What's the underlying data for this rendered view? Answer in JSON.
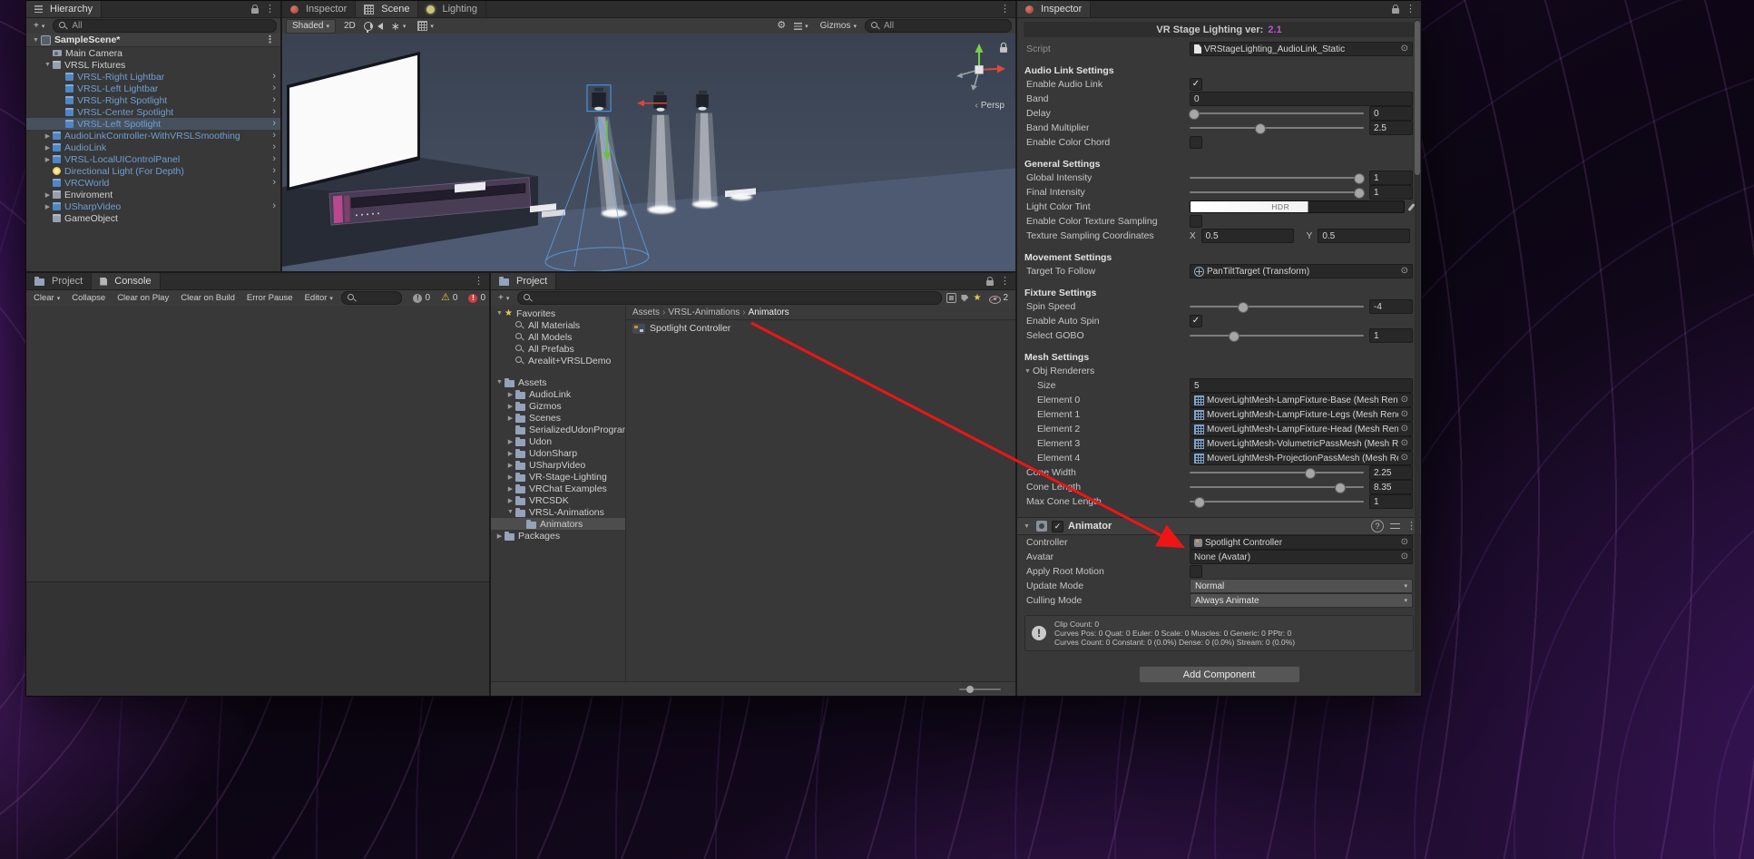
{
  "colors": {
    "selection_blue": "#47515e",
    "prefab_text": "#6f9fd6",
    "version_accent": "#c44fd4",
    "annotation_red": "#ed1515",
    "folder_icon": "#94a3bb"
  },
  "hierarchy": {
    "tab": "Hierarchy",
    "add_button": "+",
    "search_text": "All",
    "scene_label": "SampleScene*",
    "items": [
      {
        "label": "Main Camera",
        "lvl": 1,
        "icon": "camera",
        "prefab": false
      },
      {
        "label": "VRSL Fixtures",
        "lvl": 1,
        "icon": "cube",
        "prefab": false,
        "fold": "open"
      },
      {
        "label": "VRSL-Right Lightbar",
        "lvl": 2,
        "icon": "prefab",
        "prefab": true,
        "chev": true
      },
      {
        "label": "VRSL-Left Lightbar",
        "lvl": 2,
        "icon": "prefab",
        "prefab": true,
        "chev": true
      },
      {
        "label": "VRSL-Right Spotlight",
        "lvl": 2,
        "icon": "prefab",
        "prefab": true,
        "chev": true
      },
      {
        "label": "VRSL-Center Spotlight",
        "lvl": 2,
        "icon": "prefab",
        "prefab": true,
        "chev": true
      },
      {
        "label": "VRSL-Left Spotlight",
        "lvl": 2,
        "icon": "prefab",
        "prefab": true,
        "chev": true,
        "selected": true
      },
      {
        "label": "AudioLinkController-WithVRSLSmoothing",
        "lvl": 1,
        "icon": "prefab",
        "prefab": true,
        "fold": "closed",
        "chev": true
      },
      {
        "label": "AudioLink",
        "lvl": 1,
        "icon": "prefab",
        "prefab": true,
        "fold": "closed",
        "chev": true
      },
      {
        "label": "VRSL-LocalUIControlPanel",
        "lvl": 1,
        "icon": "prefab",
        "prefab": true,
        "fold": "closed",
        "chev": true
      },
      {
        "label": "Directional Light (For Depth)",
        "lvl": 1,
        "icon": "light",
        "prefab": true,
        "chev": true
      },
      {
        "label": "VRCWorld",
        "lvl": 1,
        "icon": "prefab",
        "prefab": true,
        "chev": true
      },
      {
        "label": "Enviroment",
        "lvl": 1,
        "icon": "cube",
        "prefab": false,
        "fold": "closed"
      },
      {
        "label": "USharpVideo",
        "lvl": 1,
        "icon": "prefab",
        "prefab": true,
        "fold": "closed",
        "chev": true
      },
      {
        "label": "GameObject",
        "lvl": 1,
        "icon": "cube",
        "prefab": false
      }
    ]
  },
  "scene_view": {
    "tabs": [
      {
        "label": "Inspector",
        "active": false
      },
      {
        "label": "Scene",
        "active": true
      },
      {
        "label": "Lighting",
        "active": false
      }
    ],
    "toolbar": {
      "shading_mode": "Shaded",
      "mode_2d": "2D",
      "gizmos_label": "Gizmos",
      "search_text": "All"
    },
    "persp_label": "Persp"
  },
  "console": {
    "tabs": [
      {
        "label": "Project",
        "active": false
      },
      {
        "label": "Console",
        "active": true
      }
    ],
    "buttons": [
      "Clear",
      "Collapse",
      "Clear on Play",
      "Clear on Build",
      "Error Pause"
    ],
    "editor_dropdown": "Editor",
    "counts": {
      "info": "0",
      "warnings": "0",
      "errors": "0"
    }
  },
  "project": {
    "tab": "Project",
    "add_button": "+",
    "hidden_count": "2",
    "tree": [
      {
        "label": "Favorites",
        "lvl": 0,
        "icon": "star",
        "fold": "open"
      },
      {
        "label": "All Materials",
        "lvl": 1,
        "icon": "search"
      },
      {
        "label": "All Models",
        "lvl": 1,
        "icon": "search"
      },
      {
        "label": "All Prefabs",
        "lvl": 1,
        "icon": "search"
      },
      {
        "label": "Arealit+VRSLDemo",
        "lvl": 1,
        "icon": "search"
      },
      {
        "gap": true
      },
      {
        "label": "Assets",
        "lvl": 0,
        "icon": "folder",
        "fold": "open"
      },
      {
        "label": "AudioLink",
        "lvl": 1,
        "icon": "folder",
        "fold": "closed"
      },
      {
        "label": "Gizmos",
        "lvl": 1,
        "icon": "folder",
        "fold": "closed"
      },
      {
        "label": "Scenes",
        "lvl": 1,
        "icon": "folder",
        "fold": "closed"
      },
      {
        "label": "SerializedUdonProgran",
        "lvl": 1,
        "icon": "folder"
      },
      {
        "label": "Udon",
        "lvl": 1,
        "icon": "folder",
        "fold": "closed"
      },
      {
        "label": "UdonSharp",
        "lvl": 1,
        "icon": "folder",
        "fold": "closed"
      },
      {
        "label": "USharpVideo",
        "lvl": 1,
        "icon": "folder",
        "fold": "closed"
      },
      {
        "label": "VR-Stage-Lighting",
        "lvl": 1,
        "icon": "folder",
        "fold": "closed"
      },
      {
        "label": "VRChat Examples",
        "lvl": 1,
        "icon": "folder",
        "fold": "closed"
      },
      {
        "label": "VRCSDK",
        "lvl": 1,
        "icon": "folder",
        "fold": "closed"
      },
      {
        "label": "VRSL-Animations",
        "lvl": 1,
        "icon": "folder",
        "fold": "open"
      },
      {
        "label": "Animators",
        "lvl": 2,
        "icon": "folder",
        "selected": true
      },
      {
        "label": "Packages",
        "lvl": 0,
        "icon": "folder",
        "fold": "closed"
      }
    ],
    "breadcrumb": [
      "Assets",
      "VRSL-Animations",
      "Animators"
    ],
    "items": [
      {
        "label": "Spotlight Controller",
        "type": "animator-controller"
      }
    ]
  },
  "inspector": {
    "tab": "Inspector",
    "header": {
      "title": "VR Stage Lighting ver:",
      "version": "2.1"
    },
    "rows": [
      {
        "type": "object",
        "label": "Script",
        "value": "VRStageLighting_AudioLink_Static",
        "icon": "script",
        "disabled": true
      },
      {
        "type": "header",
        "label": "Audio Link Settings"
      },
      {
        "type": "checkbox",
        "label": "Enable Audio Link",
        "checked": true
      },
      {
        "type": "field",
        "label": "Band",
        "value": "0"
      },
      {
        "type": "slider",
        "label": "Delay",
        "value": "0",
        "pct": 2
      },
      {
        "type": "slider",
        "label": "Band Multiplier",
        "value": "2.5",
        "pct": 40
      },
      {
        "type": "checkbox",
        "label": "Enable Color Chord",
        "checked": false
      },
      {
        "type": "header",
        "label": "General Settings"
      },
      {
        "type": "slider",
        "label": "Global Intensity",
        "value": "1",
        "pct": 97
      },
      {
        "type": "slider",
        "label": "Final Intensity",
        "value": "1",
        "pct": 97
      },
      {
        "type": "color",
        "label": "Light Color Tint",
        "badge": "HDR"
      },
      {
        "type": "checkbox",
        "label": "Enable Color Texture Sampling",
        "checked": false
      },
      {
        "type": "vector2",
        "label": "Texture Sampling Coordinates",
        "x_label": "X",
        "x": "0.5",
        "y_label": "Y",
        "y": "0.5"
      },
      {
        "type": "header",
        "label": "Movement Settings"
      },
      {
        "type": "object",
        "label": "Target To Follow",
        "value": "PanTiltTarget (Transform)",
        "icon": "transform"
      },
      {
        "type": "header",
        "label": "Fixture Settings"
      },
      {
        "type": "slider",
        "label": "Spin Speed",
        "value": "-4",
        "pct": 30
      },
      {
        "type": "checkbox",
        "label": "Enable Auto Spin",
        "checked": true
      },
      {
        "type": "slider",
        "label": "Select GOBO",
        "value": "1",
        "pct": 25
      },
      {
        "type": "header",
        "label": "Mesh Settings"
      },
      {
        "type": "foldout",
        "label": "Obj Renderers",
        "open": true
      },
      {
        "type": "field",
        "label": "Size",
        "value": "5",
        "indent": 1
      },
      {
        "type": "object",
        "label": "Element 0",
        "value": "MoverLightMesh-LampFixture-Base (Mesh Rend",
        "icon": "mesh",
        "indent": 1
      },
      {
        "type": "object",
        "label": "Element 1",
        "value": "MoverLightMesh-LampFixture-Legs (Mesh Rend",
        "icon": "mesh",
        "indent": 1
      },
      {
        "type": "object",
        "label": "Element 2",
        "value": "MoverLightMesh-LampFixture-Head (Mesh Rend",
        "icon": "mesh",
        "indent": 1
      },
      {
        "type": "object",
        "label": "Element 3",
        "value": "MoverLightMesh-VolumetricPassMesh (Mesh Re",
        "icon": "mesh",
        "indent": 1
      },
      {
        "type": "object",
        "label": "Element 4",
        "value": "MoverLightMesh-ProjectionPassMesh (Mesh Re",
        "icon": "mesh",
        "indent": 1
      },
      {
        "type": "slider",
        "label": "Cone Width",
        "value": "2.25",
        "pct": 69
      },
      {
        "type": "slider",
        "label": "Cone Length",
        "value": "8.35",
        "pct": 86
      },
      {
        "type": "slider",
        "label": "Max Cone Length",
        "value": "1",
        "pct": 5
      }
    ],
    "animator": {
      "title": "Animator",
      "rows": [
        {
          "type": "object",
          "label": "Controller",
          "value": "Spotlight Controller",
          "icon": "anim"
        },
        {
          "type": "object",
          "label": "Avatar",
          "value": "None (Avatar)",
          "icon": "none"
        },
        {
          "type": "checkbox",
          "label": "Apply Root Motion",
          "checked": false
        },
        {
          "type": "dropdown",
          "label": "Update Mode",
          "value": "Normal"
        },
        {
          "type": "dropdown",
          "label": "Culling Mode",
          "value": "Always Animate"
        }
      ],
      "info_lines": [
        "Clip Count: 0",
        "Curves Pos: 0 Quat: 0 Euler: 0 Scale: 0 Muscles: 0 Generic: 0 PPtr: 0",
        "Curves Count: 0 Constant: 0 (0.0%) Dense: 0 (0.0%) Stream: 0 (0.0%)"
      ]
    },
    "add_component": "Add Component"
  },
  "annotation": {
    "type": "arrow",
    "color": "#ed1515",
    "from": [
      828,
      356
    ],
    "to": [
      1298,
      600
    ]
  }
}
